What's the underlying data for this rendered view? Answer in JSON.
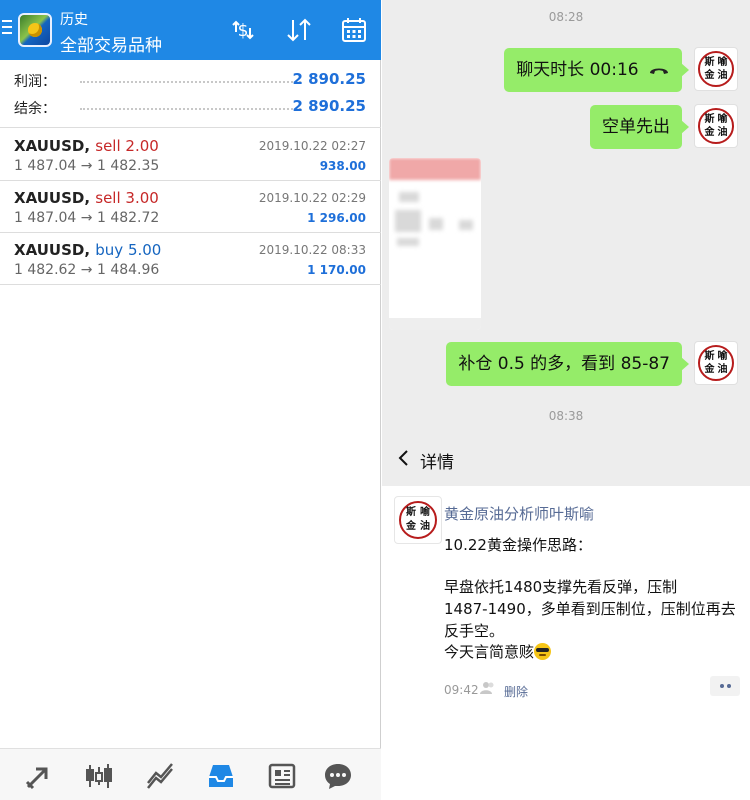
{
  "mt": {
    "header": {
      "subtitle": "历史",
      "title": "全部交易品种"
    },
    "summary": [
      {
        "label": "利润：",
        "value": "2 890.25"
      },
      {
        "label": "结余：",
        "value": "2 890.25"
      }
    ],
    "deals": [
      {
        "symbol": "XAUUSD,",
        "action": "sell 2.00",
        "type": "sell",
        "prices": "1 487.04 → 1 482.35",
        "time": "2019.10.22 02:27",
        "profit": "938.00"
      },
      {
        "symbol": "XAUUSD,",
        "action": "sell 3.00",
        "type": "sell",
        "prices": "1 487.04 → 1 482.72",
        "time": "2019.10.22 02:29",
        "profit": "1 296.00"
      },
      {
        "symbol": "XAUUSD,",
        "action": "buy 5.00",
        "type": "buy",
        "prices": "1 482.62 → 1 484.96",
        "time": "2019.10.22 08:33",
        "profit": "1 170.00"
      }
    ],
    "toolbar_icons": [
      "dollar-exchange-icon",
      "sort-arrows-icon",
      "calendar-icon"
    ],
    "nav_icons": [
      "trade-arrow-icon",
      "candlestick-icon",
      "chart-line-icon",
      "history-inbox-icon",
      "news-icon",
      "chat-icon"
    ],
    "accent": "#1f88e5"
  },
  "chat": {
    "time1": "08:28",
    "messages": [
      {
        "text": "聊天时长 00:16",
        "icon": "phone-hangup-icon"
      },
      {
        "text": "空单先出"
      },
      {
        "text": "补仓 0.5 的多，看到 85-87"
      }
    ],
    "time2": "08:38",
    "avatar_chars": [
      "斯",
      "喻",
      "金",
      "油"
    ],
    "bubble_color": "#95ec69"
  },
  "detail": {
    "title": "详情",
    "name": "黄金原油分析师叶斯喻",
    "lines": [
      "10.22黄金操作思路：",
      "",
      "早盘依托1480支撑先看反弹，压制",
      "1487-1490，多单看到压制位，压制位再去",
      "反手空。",
      "今天言简意赅"
    ],
    "time": "09:42",
    "delete": "删除"
  }
}
